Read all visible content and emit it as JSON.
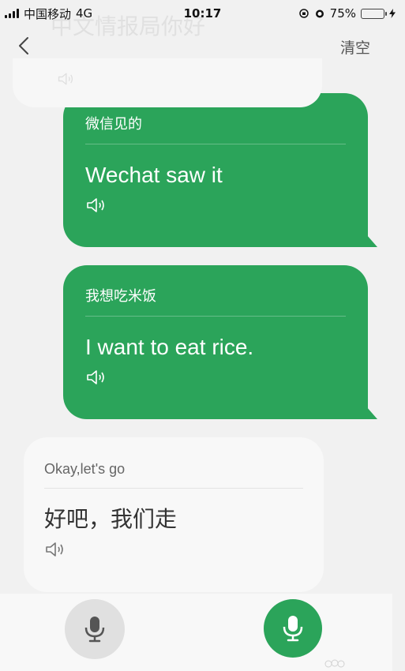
{
  "status_bar": {
    "carrier": "中国移动",
    "network": "4G",
    "time": "10:17",
    "battery": "75%",
    "battery_level": 0.75
  },
  "header": {
    "faded_title": "中文情报局你好",
    "clear_label": "清空"
  },
  "messages": [
    {
      "side": "right",
      "source": "微信见的",
      "translation": "Wechat saw it"
    },
    {
      "side": "right",
      "source": "我想吃米饭",
      "translation": "I want to eat rice."
    },
    {
      "side": "left",
      "source": "Okay,let's go",
      "translation": "好吧，我们走"
    }
  ],
  "colors": {
    "accent": "#2ba45a",
    "gray_bubble": "#f8f8f8"
  },
  "icons": {
    "back": "chevron-left-icon",
    "speaker": "speaker-icon",
    "mic": "microphone-icon"
  }
}
